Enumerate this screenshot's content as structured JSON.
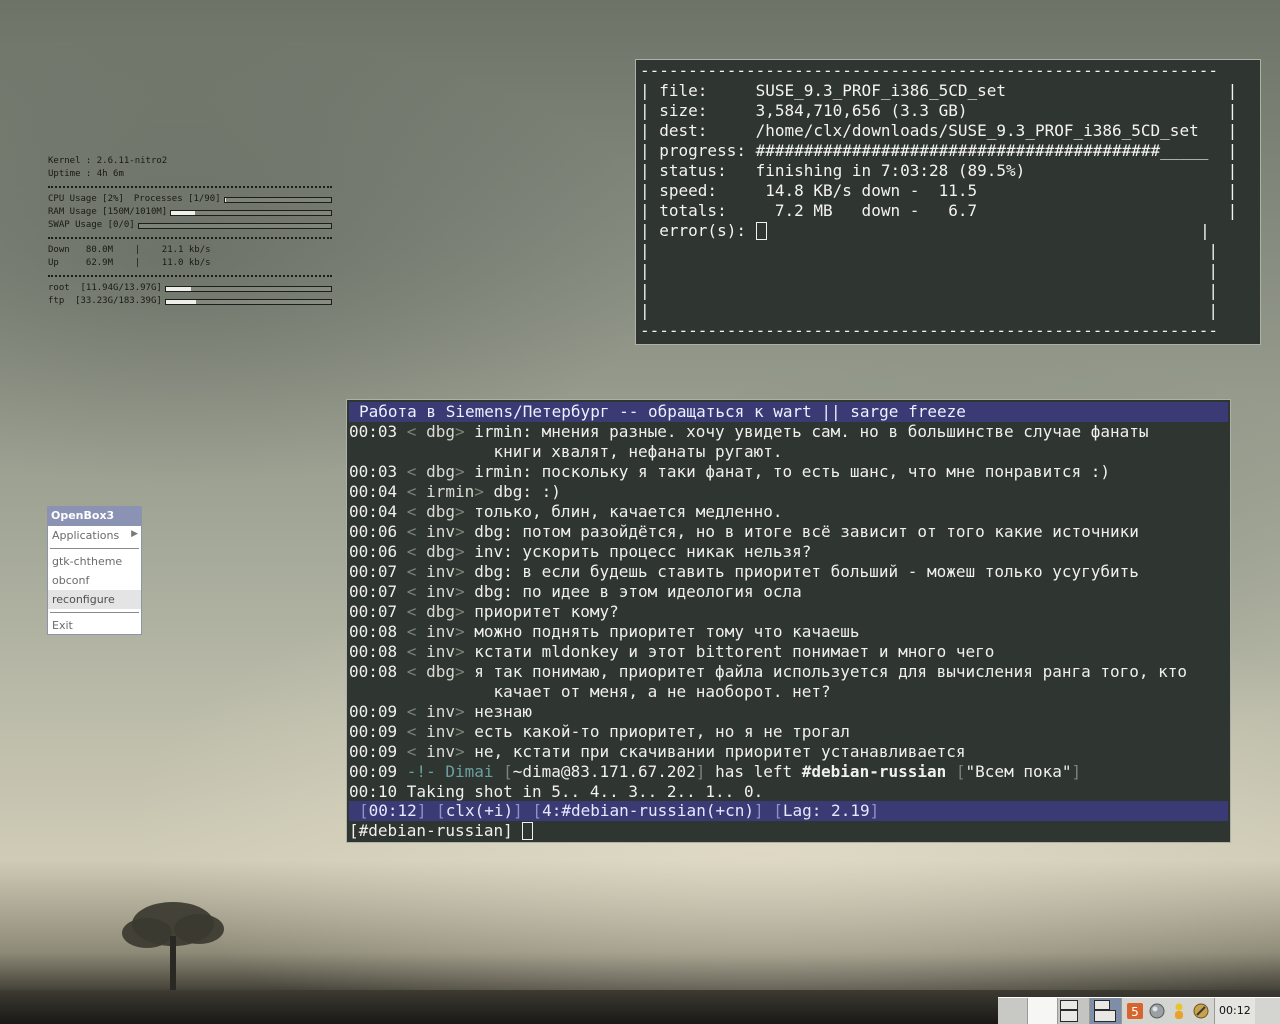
{
  "conky": {
    "kernel": "Kernel : 2.6.11-nitro2",
    "uptime": "Uptime : 4h 6m",
    "cpu": "CPU Usage [2%]",
    "processes": "Processes [1/90]",
    "ram": "RAM Usage [150M/1010M]",
    "swap": "SWAP Usage [0/0]",
    "down": "Down   80.0M    |    21.1 kb/s",
    "up": "Up     62.9M    |    11.0 kb/s",
    "root": "root  [11.94G/13.97G]",
    "ftp": "ftp  [33.23G/183.39G]",
    "cpu_pct": 0.02,
    "proc_pct": 0.01,
    "ram_pct": 0.15,
    "swap_pct": 0,
    "root_pct": 0.15,
    "ftp_pct": 0.18
  },
  "download": {
    "lines": [
      "------------------------------------------------------------",
      "| file:     SUSE_9.3_PROF_i386_5CD_set                       |",
      "| size:     3,584,710,656 (3.3 GB)                           |",
      "| dest:     /home/clx/downloads/SUSE_9.3_PROF_i386_5CD_set   |",
      "| progress: ##########################################_____  |",
      "| status:   finishing in 7:03:28 (89.5%)                     |",
      "| speed:     14.8 KB/s down -  11.5                          |",
      "| totals:     7.2 MB   down -   6.7                          |",
      "| error(s): ",
      "|                                                          |",
      "|                                                          |",
      "|                                                          |",
      "|                                                          |",
      "------------------------------------------------------------"
    ],
    "progress_pct": 89.5
  },
  "irc": {
    "topic": "Работа в Siemens/Петербург -- обращаться к wart || sarge freeze",
    "messages": [
      {
        "time": "00:03",
        "nick": "dbg",
        "text": "irmin: мнения разные. хочу увидеть сам. но в большинстве случае фанаты"
      },
      {
        "time": "",
        "nick": "",
        "text": "книги хвалят, нефанаты ругают."
      },
      {
        "time": "00:03",
        "nick": "dbg",
        "text": "irmin: поскольку я таки фанат, то есть шанс, что мне понравится :)"
      },
      {
        "time": "00:04",
        "nick": "irmin",
        "text": "dbg: :)"
      },
      {
        "time": "00:04",
        "nick": "dbg",
        "text": "только, блин, качается медленно."
      },
      {
        "time": "00:06",
        "nick": "inv",
        "text": "dbg: потом разойдётся, но в итоге всё зависит от того какие источники"
      },
      {
        "time": "00:06",
        "nick": "dbg",
        "text": "inv: ускорить процесс никак нельзя?"
      },
      {
        "time": "00:07",
        "nick": "inv",
        "text": "dbg: в если будешь ставить приоритет больший - можеш только усугубить"
      },
      {
        "time": "00:07",
        "nick": "inv",
        "text": "dbg: по идее в этом идеология осла"
      },
      {
        "time": "00:07",
        "nick": "dbg",
        "text": "приоритет кому?"
      },
      {
        "time": "00:08",
        "nick": "inv",
        "text": "можно поднять приоритет тому что качаешь"
      },
      {
        "time": "00:08",
        "nick": "inv",
        "text": "кстати mldonkey и этот bittorent понимает и много чего"
      },
      {
        "time": "00:08",
        "nick": "dbg",
        "text": "я так понимаю, приоритет файла используется для вычисления ранга того, кто"
      },
      {
        "time": "",
        "nick": "",
        "text": "качает от меня, а не наоборот. нет?"
      },
      {
        "time": "00:09",
        "nick": "inv",
        "text": "незнаю"
      },
      {
        "time": "00:09",
        "nick": "inv",
        "text": "есть какой-то приоритет, но я не трогал"
      },
      {
        "time": "00:09",
        "nick": "inv",
        "text": "не, кстати при скачивании приоритет устанавливается"
      }
    ],
    "quit": {
      "time": "00:09",
      "marker": "-!-",
      "nick": "Dimai",
      "host": "~dima@83.171.67.202",
      "action": "has left",
      "channel": "#debian-russian",
      "reason": "Всем пока"
    },
    "shot": {
      "time": "00:10",
      "text": "Taking shot in 5.. 4.. 3.. 2.. 1.. 0."
    },
    "status": {
      "time": "00:12",
      "user": "clx(+i)",
      "window": "4:#debian-russian(+cn)",
      "lag": "Lag: 2.19"
    },
    "prompt": "[#debian-russian] "
  },
  "menu": {
    "title": "OpenBox3",
    "items": [
      "Applications",
      "gtk-chtheme",
      "obconf",
      "reconfigure",
      "Exit"
    ]
  },
  "taskbar": {
    "clock": "00:12"
  }
}
